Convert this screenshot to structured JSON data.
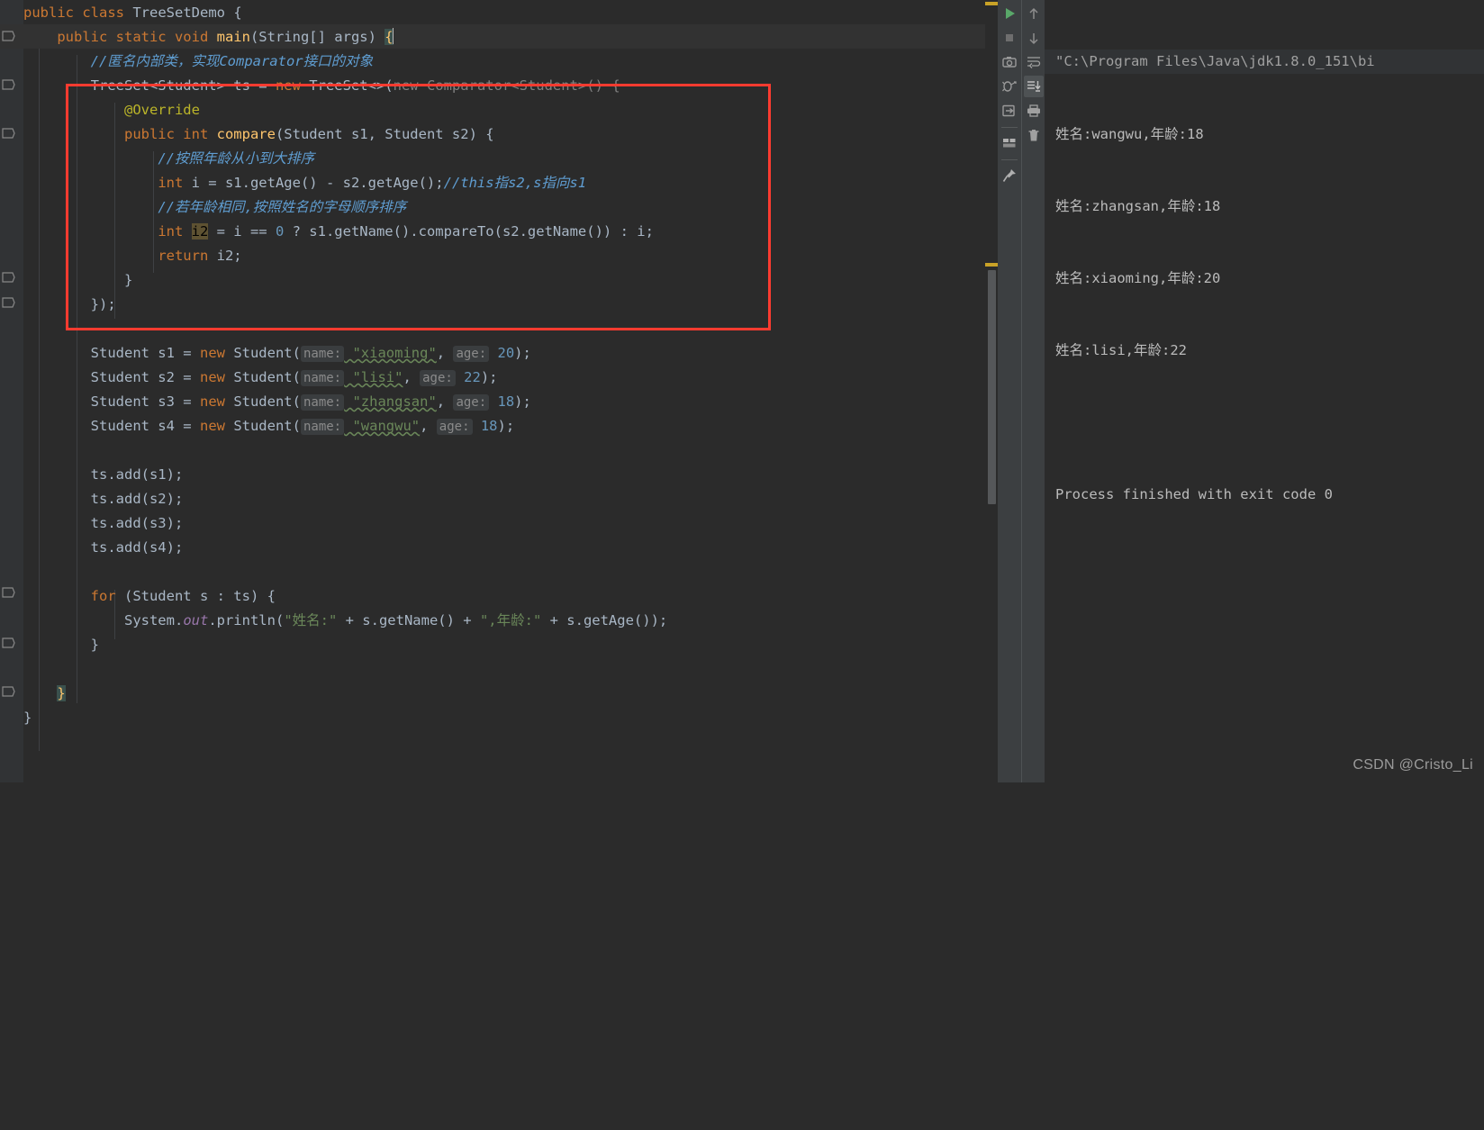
{
  "editor": {
    "lines": [
      "public class TreeSetDemo {",
      "    public static void main(String[] args) {",
      "        //匿名内部类，实现Comparator接口的对象",
      "        TreeSet<Student> ts = new TreeSet<>(new Comparator<Student>() {",
      "            @Override",
      "            public int compare(Student s1, Student s2) {",
      "                //按照年龄从小到大排序",
      "                int i = s1.getAge() - s2.getAge();//this指s2,s指向s1",
      "                //若年龄相同,按照姓名的字母顺序排序",
      "                int i2 = i == 0 ? s1.getName().compareTo(s2.getName()) : i;",
      "                return i2;",
      "            }",
      "        });",
      "",
      "        Student s1 = new Student( name: \"xiaoming\",  age: 20);",
      "        Student s2 = new Student( name: \"lisi\",  age: 22);",
      "        Student s3 = new Student( name: \"zhangsan\",  age: 18);",
      "        Student s4 = new Student( name: \"wangwu\",  age: 18);",
      "",
      "        ts.add(s1);",
      "        ts.add(s2);",
      "        ts.add(s3);",
      "        ts.add(s4);",
      "",
      "        for (Student s : ts) {",
      "            System.out.println(\"姓名:\" + s.getName() + \",年龄:\" + s.getAge());",
      "        }",
      "",
      "    }",
      "}"
    ],
    "class_name": "TreeSetDemo",
    "method_name": "main",
    "inlay_hints": [
      "name:",
      "age:"
    ],
    "selected_token": "i2",
    "string_values": [
      "xiaoming",
      "lisi",
      "zhangsan",
      "wangwu"
    ],
    "age_values": [
      20,
      22,
      18,
      18
    ],
    "comments": [
      "//匿名内部类，实现Comparator接口的对象",
      "//按照年龄从小到大排序",
      "//this指s2,s指向s1",
      "//若年龄相同,按照姓名的字母顺序排序"
    ],
    "annotation_box_color": "#ff3b30"
  },
  "run_toolwindow": {
    "toolbar_left": [
      {
        "name": "rerun-icon",
        "glyph": "play"
      },
      {
        "name": "stop-icon",
        "glyph": "stop"
      },
      {
        "name": "screenshot-icon",
        "glyph": "camera"
      },
      {
        "name": "attach-debugger-icon",
        "glyph": "bug"
      },
      {
        "name": "export-icon",
        "glyph": "export"
      },
      {
        "name": "layout-icon",
        "glyph": "layout"
      },
      {
        "name": "pin-icon",
        "glyph": "pin"
      }
    ],
    "toolbar_right": [
      {
        "name": "up-arrow-icon",
        "glyph": "up"
      },
      {
        "name": "down-arrow-icon",
        "glyph": "down"
      },
      {
        "name": "soft-wrap-icon",
        "glyph": "wrap"
      },
      {
        "name": "scroll-to-end-icon",
        "glyph": "scroll-end",
        "active": true
      },
      {
        "name": "print-icon",
        "glyph": "print"
      },
      {
        "name": "clear-all-icon",
        "glyph": "trash"
      }
    ],
    "console": {
      "command_line": "\"C:\\Program Files\\Java\\jdk1.8.0_151\\bi",
      "output": [
        "姓名:wangwu,年龄:18",
        "姓名:zhangsan,年龄:18",
        "姓名:xiaoming,年龄:20",
        "姓名:lisi,年龄:22",
        "",
        "Process finished with exit code 0"
      ]
    }
  },
  "watermark": {
    "text": "CSDN @Cristo_Li"
  }
}
